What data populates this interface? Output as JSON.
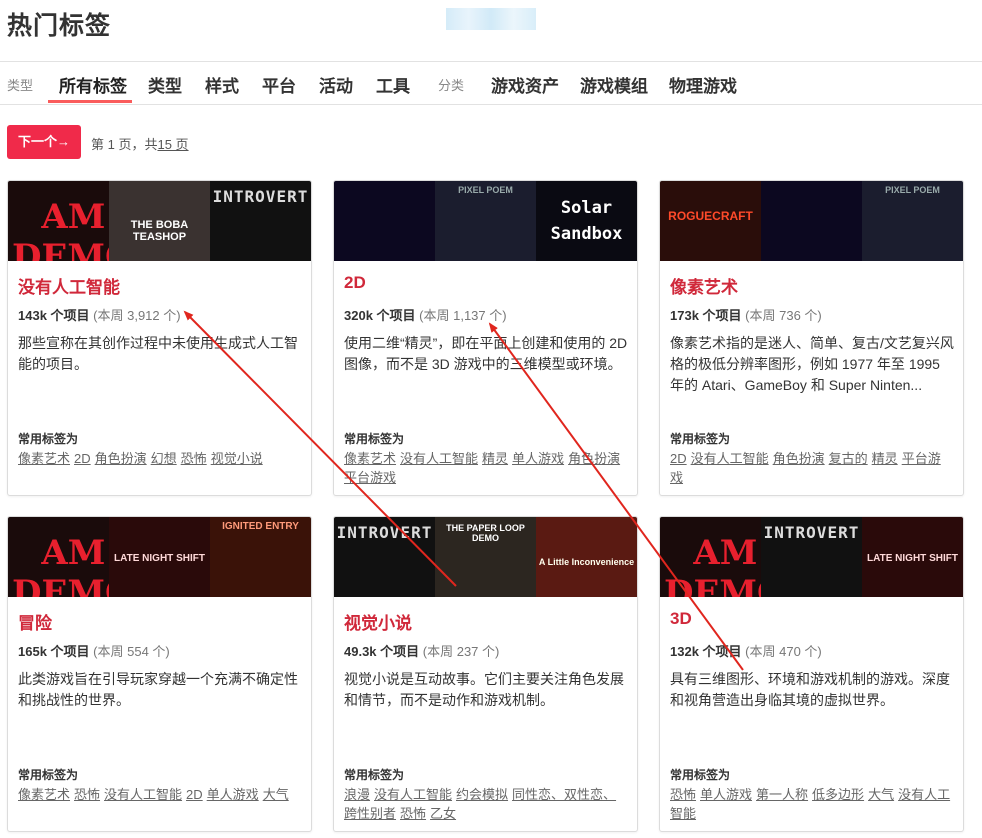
{
  "header": {
    "title": "热门标签"
  },
  "nav": {
    "group_type_label": "类型",
    "items_a": [
      "所有标签",
      "类型",
      "样式",
      "平台",
      "活动",
      "工具"
    ],
    "group_category_label": "分类",
    "items_b": [
      "游戏资产",
      "游戏模组",
      "物理游戏"
    ],
    "active": "所有标签"
  },
  "pager": {
    "next_label": "下一个→",
    "page_text": "第 1 页，共",
    "total_text": "15 页"
  },
  "common_tags_label": "常用标签为",
  "colors": {
    "accent": "#f02a4a",
    "title_red": "#d0283a"
  },
  "cards": [
    {
      "title": "没有人工智能",
      "count": "143k 个项目",
      "week": "(本周 3,912 个)",
      "desc": "那些宣称在其创作过程中未使用生成式人工智能的项目。",
      "tags": [
        "像素艺术",
        "2D",
        "角色扮演",
        "幻想",
        "恐怖",
        "视觉小说"
      ],
      "thumbs": [
        "AM DEMO",
        "THE BOBA TEASHOP",
        "INTROVERT"
      ]
    },
    {
      "title": "2D",
      "count": "320k 个项目",
      "week": "(本周 1,137 个)",
      "desc": "使用二维“精灵”，即在平面上创建和使用的 2D 图像，而不是 3D 游戏中的三维模型或环境。",
      "tags": [
        "像素艺术",
        "没有人工智能",
        "精灵",
        "单人游戏",
        "角色扮演",
        "平台游戏"
      ],
      "thumbs": [
        "",
        "PIXEL POEM",
        "Solar Sandbox"
      ]
    },
    {
      "title": "像素艺术",
      "count": "173k 个项目",
      "week": "(本周 736 个)",
      "desc": "像素艺术指的是迷人、简单、复古/文艺复兴风格的极低分辨率图形，例如 1977 年至 1995 年的 Atari、GameBoy 和 Super Ninten...",
      "tags": [
        "2D",
        "没有人工智能",
        "角色扮演",
        "复古的",
        "精灵",
        "平台游戏"
      ],
      "thumbs": [
        "ROGUECRAFT",
        "",
        "PIXEL POEM"
      ]
    },
    {
      "title": "冒险",
      "count": "165k 个项目",
      "week": "(本周 554 个)",
      "desc": "此类游戏旨在引导玩家穿越一个充满不确定性和挑战性的世界。",
      "tags": [
        "像素艺术",
        "恐怖",
        "没有人工智能",
        "2D",
        "单人游戏",
        "大气"
      ],
      "thumbs": [
        "AM DEMO",
        "LATE NIGHT SHIFT",
        "IGNITED ENTRY"
      ]
    },
    {
      "title": "视觉小说",
      "count": "49.3k 个项目",
      "week": "(本周 237 个)",
      "desc": "视觉小说是互动故事。它们主要关注角色发展和情节，而不是动作和游戏机制。",
      "tags": [
        "浪漫",
        "没有人工智能",
        "约会模拟",
        "同性恋、双性恋、跨性别者",
        "恐怖",
        "乙女"
      ],
      "thumbs": [
        "INTROVERT",
        "THE PAPER LOOP DEMO",
        "A Little Inconvenience"
      ]
    },
    {
      "title": "3D",
      "count": "132k 个项目",
      "week": "(本周 470 个)",
      "desc": "具有三维图形、环境和游戏机制的游戏。深度和视角营造出身临其境的虚拟世界。",
      "tags": [
        "恐怖",
        "单人游戏",
        "第一人称",
        "低多边形",
        "大气",
        "没有人工智能"
      ],
      "thumbs": [
        "AM DEMO",
        "INTROVERT",
        "LATE NIGHT SHIFT"
      ]
    }
  ]
}
